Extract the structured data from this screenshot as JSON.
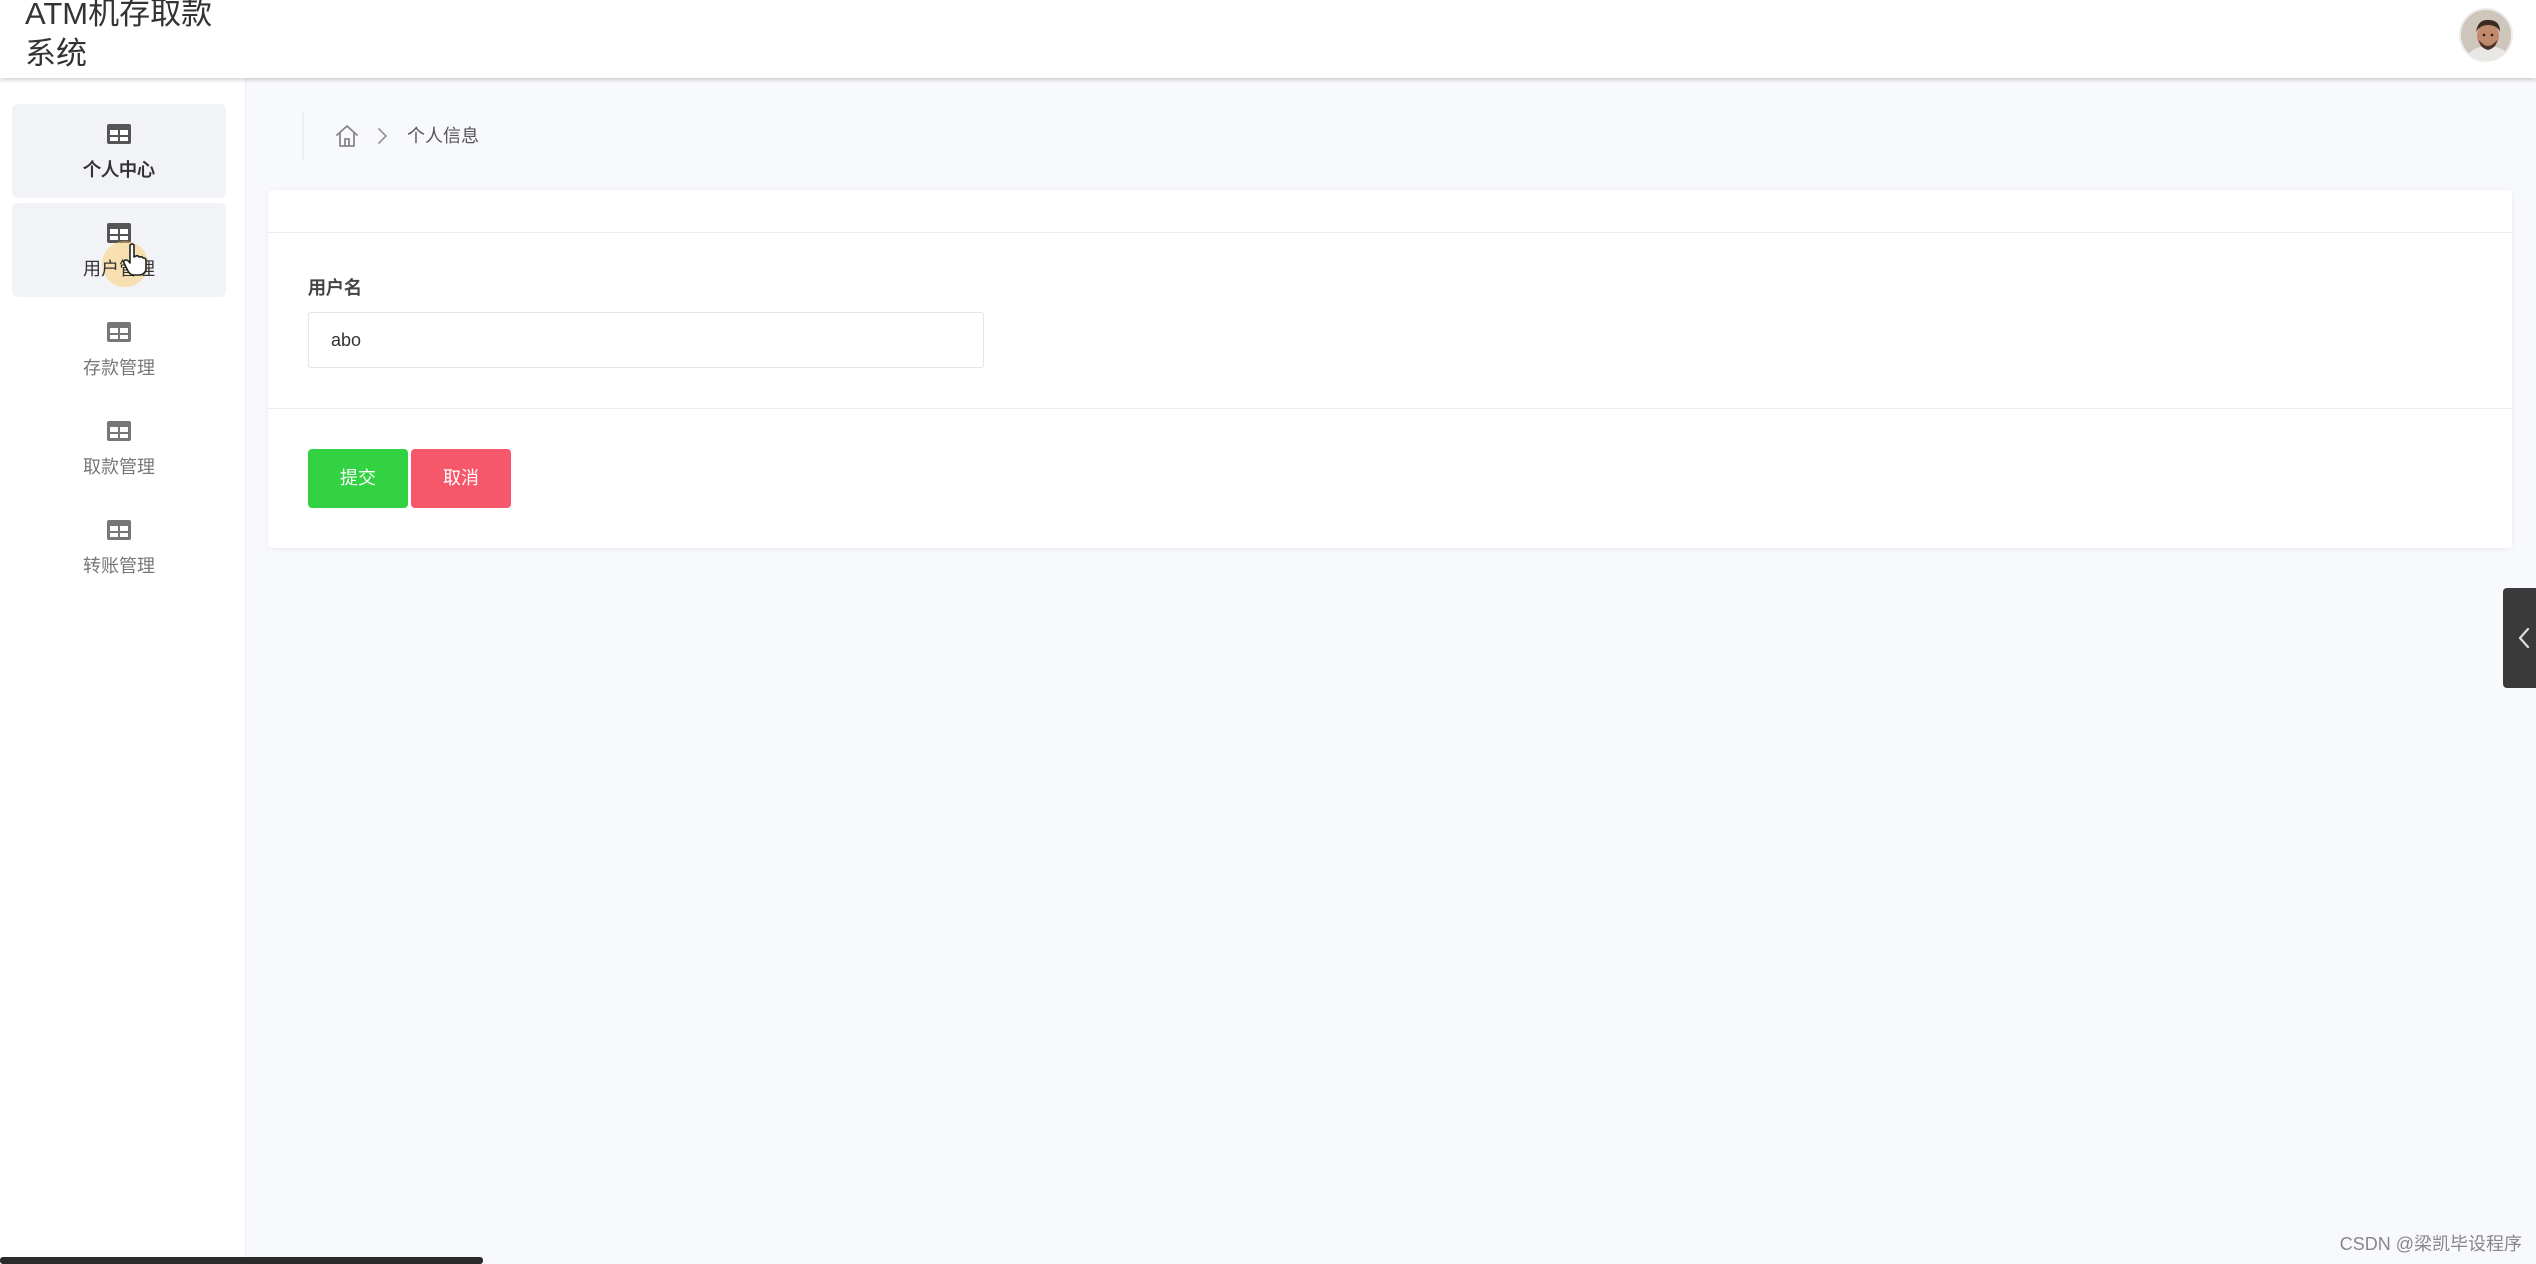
{
  "app": {
    "title_line1": "ATM机存取款",
    "title_line2": "系统"
  },
  "sidebar": {
    "items": [
      {
        "label": "个人中心",
        "icon": "table-icon",
        "state": "active"
      },
      {
        "label": "用户管理",
        "icon": "table-icon",
        "state": "hover"
      },
      {
        "label": "存款管理",
        "icon": "table-icon",
        "state": "normal"
      },
      {
        "label": "取款管理",
        "icon": "table-icon",
        "state": "normal"
      },
      {
        "label": "转账管理",
        "icon": "table-icon",
        "state": "normal"
      }
    ]
  },
  "breadcrumb": {
    "home_icon": "home-icon",
    "current": "个人信息"
  },
  "form": {
    "username_label": "用户名",
    "username_value": "abo",
    "submit_label": "提交",
    "cancel_label": "取消"
  },
  "colors": {
    "submit": "#32d243",
    "cancel": "#f5586a",
    "background": "#f8f9fc"
  },
  "watermark": "CSDN @梁凯毕设程序"
}
